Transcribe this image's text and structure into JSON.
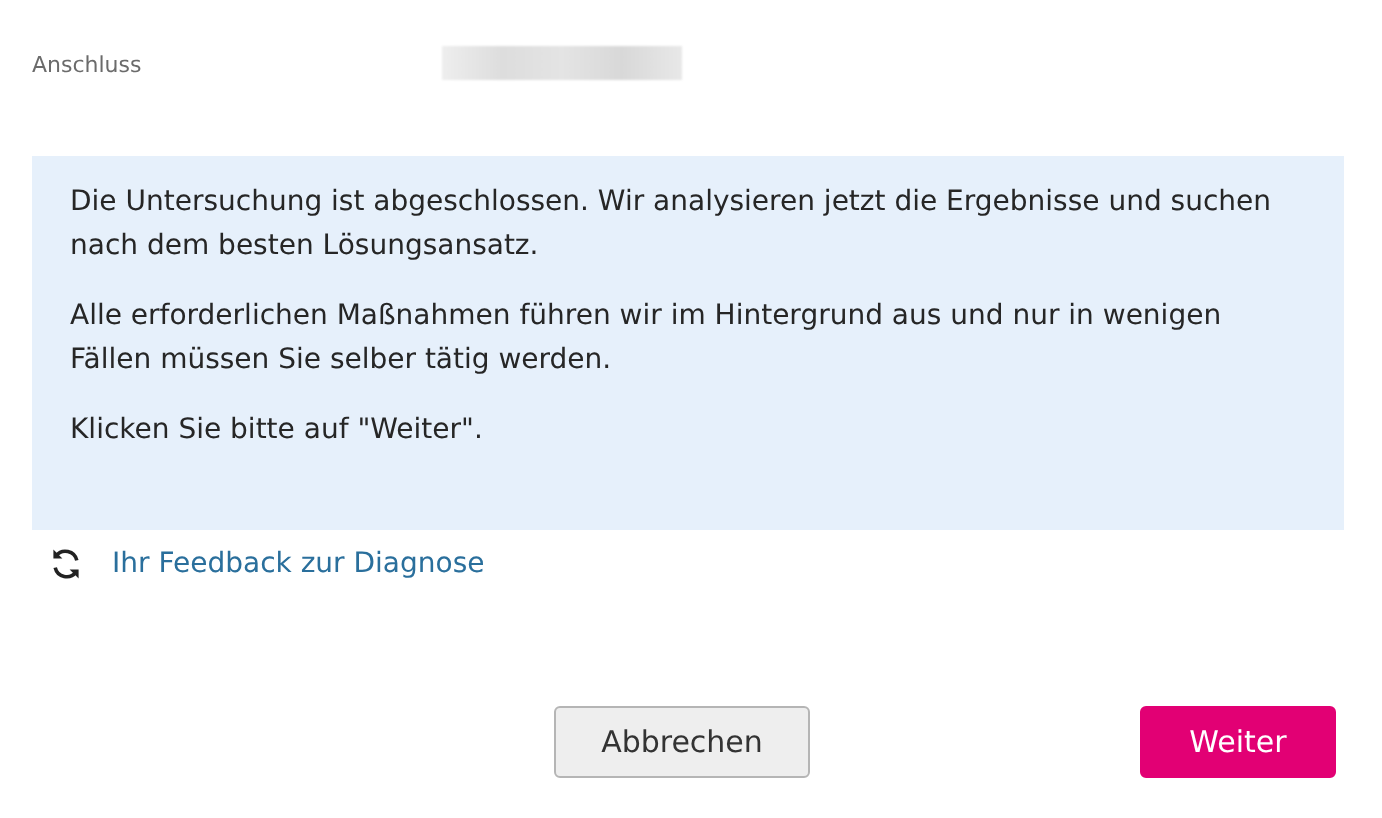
{
  "connection": {
    "label": "Anschluss"
  },
  "info": {
    "paragraphs": [
      "Die Untersuchung ist abgeschlossen. Wir analysieren jetzt die Ergebnisse und suchen nach dem besten Lösungsansatz.",
      "Alle erforderlichen Maßnahmen führen wir im Hintergrund aus und nur in wenigen Fällen müssen Sie selber tätig werden.",
      "Klicken Sie bitte auf \"Weiter\"."
    ]
  },
  "feedback_link": "Ihr Feedback zur Diagnose",
  "buttons": [
    {
      "label": "Abbrechen",
      "kind": "secondary"
    },
    {
      "label": "Weiter",
      "kind": "primary"
    }
  ]
}
